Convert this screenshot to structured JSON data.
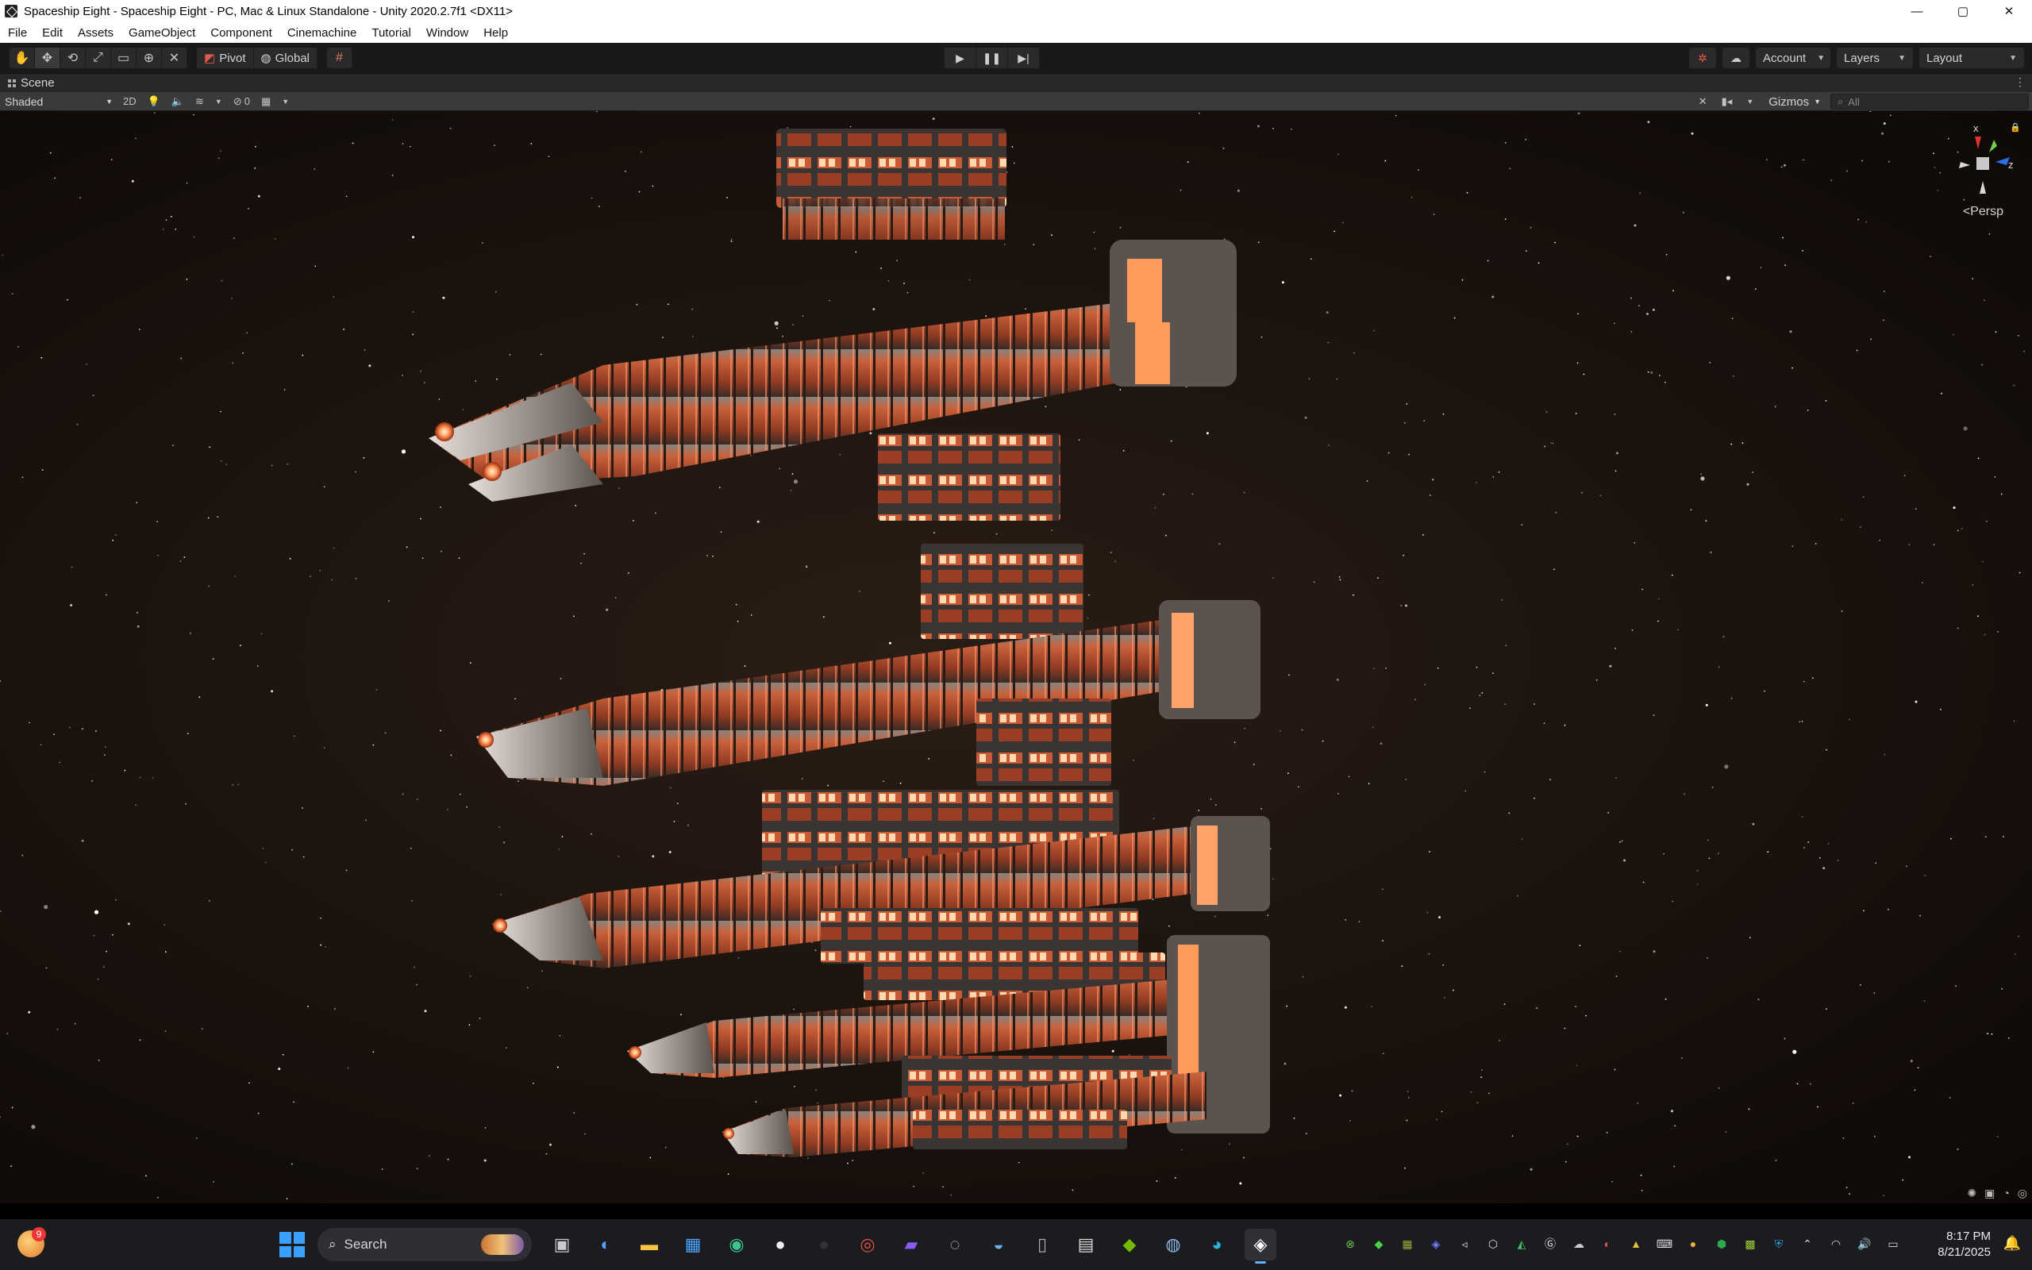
{
  "window": {
    "title": "Spaceship Eight - Spaceship Eight - PC, Mac & Linux Standalone - Unity 2020.2.7f1 <DX11>",
    "controls": [
      "—",
      "▢",
      "✕"
    ]
  },
  "menu": {
    "items": [
      "File",
      "Edit",
      "Assets",
      "GameObject",
      "Component",
      "Cinemachine",
      "Tutorial",
      "Window",
      "Help"
    ]
  },
  "toolbar": {
    "pivot_label": "Pivot",
    "global_label": "Global",
    "account_label": "Account",
    "layers_label": "Layers",
    "layout_label": "Layout"
  },
  "scene": {
    "tab_label": "Scene",
    "shading_mode": "Shaded",
    "mode_2d_label": "2D",
    "hidden_count": "0",
    "gizmos_label": "Gizmos",
    "search_placeholder": "All",
    "persp_label": "Persp",
    "axis_x": "x",
    "axis_z": "z"
  },
  "taskbar": {
    "notification_count": "9",
    "search_label": "Search",
    "time": "8:17 PM",
    "date": "8/21/2025",
    "pinned_apps": [
      "task-view",
      "copilot",
      "file-explorer",
      "microsoft-store",
      "browser-globe",
      "maps-pin",
      "dark-app",
      "chrome",
      "media-app",
      "steam",
      "edge-globe",
      "usb-device",
      "sticky-notes",
      "nvidia",
      "globe-app",
      "edge",
      "unity"
    ]
  },
  "colors": {
    "titlebar_bg": "#ffffff",
    "editor_dark": "#191919",
    "scene_toolbar": "#3a3a3a",
    "ship_hull_orange": "#c2502c",
    "ship_glow": "#ffb37a",
    "taskbar_bg": "#1b1c20"
  }
}
